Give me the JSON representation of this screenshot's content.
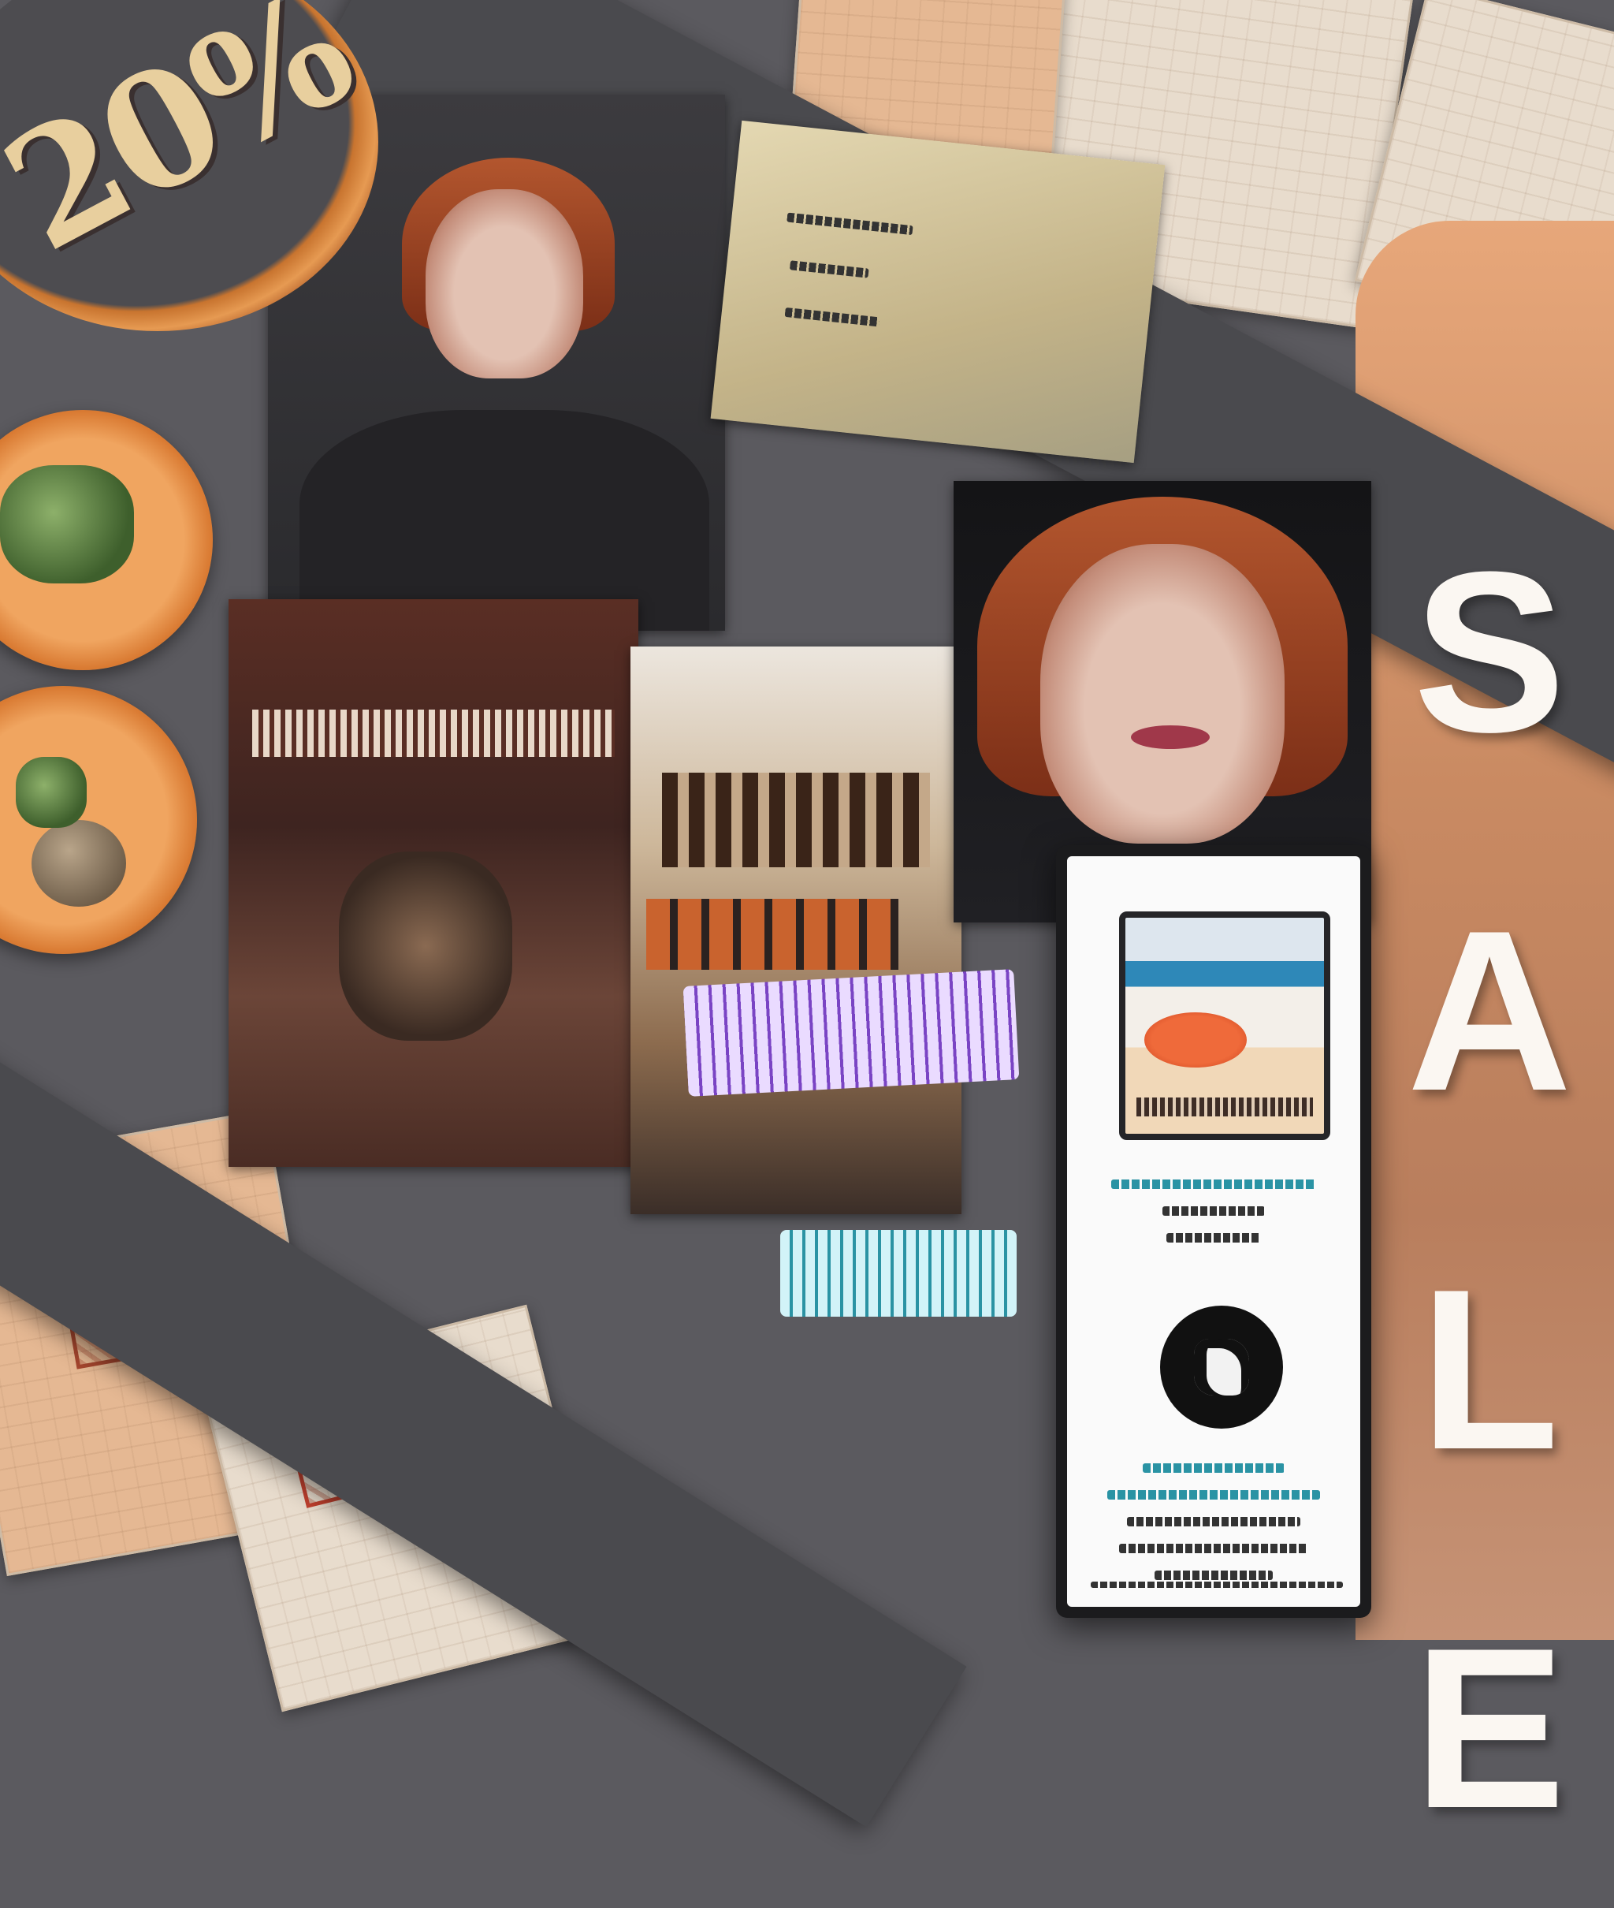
{
  "promo": {
    "discount_label": "20%",
    "sale_letters": [
      "S",
      "A",
      "L",
      "E"
    ]
  },
  "colors": {
    "background": "#5b5a5f",
    "band": "#4a4a4e",
    "badge_ring": "#d97a32",
    "badge_text": "#e8cf9e",
    "sale_text": "#fbf7f2",
    "accent_teal": "#2a93a4",
    "accent_purple": "#7a44c4"
  },
  "icons": [
    "discount-badge",
    "food-plate-icon",
    "brand-logo-icon"
  ]
}
